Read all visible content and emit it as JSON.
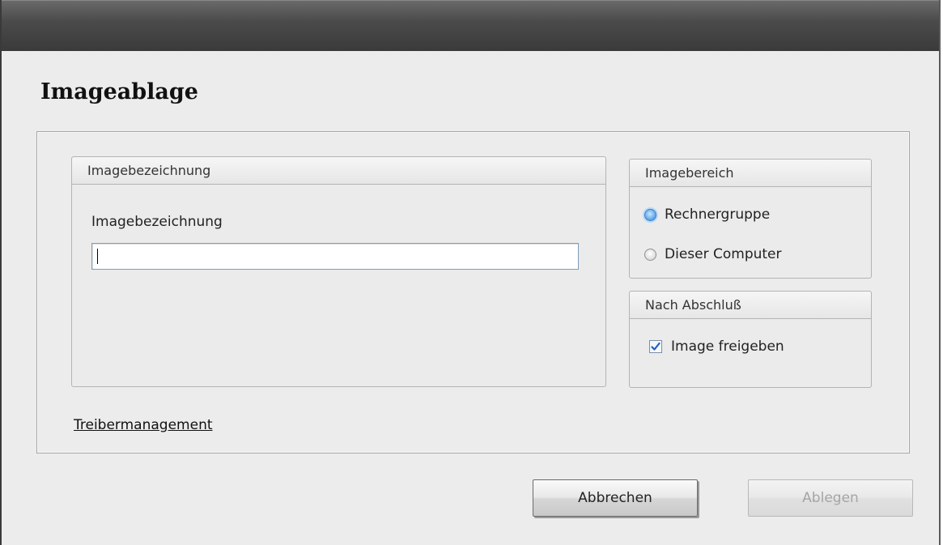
{
  "dialog": {
    "title": "Imageablage"
  },
  "name_group": {
    "header": "Imagebezeichnung",
    "field_label": "Imagebezeichnung",
    "field_value": ""
  },
  "area_group": {
    "header": "Imagebereich",
    "options": [
      {
        "label": "Rechnergruppe",
        "selected": true
      },
      {
        "label": "Dieser Computer",
        "selected": false
      }
    ]
  },
  "after_group": {
    "header": "Nach Abschluß",
    "checkbox_label": "Image freigeben",
    "checked": true
  },
  "link": {
    "label": "Treibermanagement"
  },
  "buttons": {
    "cancel": "Abbrechen",
    "save": "Ablegen",
    "save_enabled": false
  },
  "colors": {
    "titlebar": "#4b4b4b",
    "background": "#ececec",
    "radio_selected": "#3b87d3"
  }
}
